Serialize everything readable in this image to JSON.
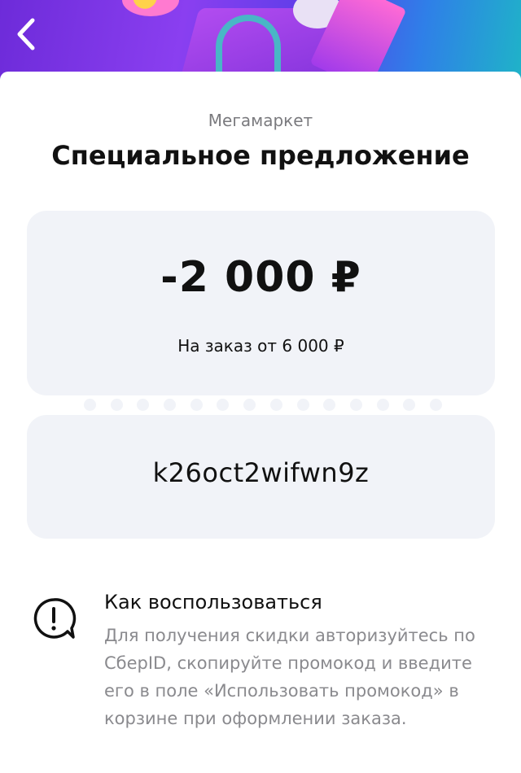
{
  "header": {
    "back_icon": "chevron-left-icon"
  },
  "offer": {
    "brand": "Мегамаркет",
    "title": "Специальное предложение",
    "amount": "-2 000 ₽",
    "condition": "На заказ от 6 000 ₽",
    "promo_code": "k26oct2wifwn9z"
  },
  "how_to": {
    "icon": "info-bubble-icon",
    "title": "Как воспользоваться",
    "text": "Для получения скидки авторизуйтесь по СберID, скопируйте промокод и введите его в поле «Использовать промокод» в корзине при оформлении заказа."
  }
}
